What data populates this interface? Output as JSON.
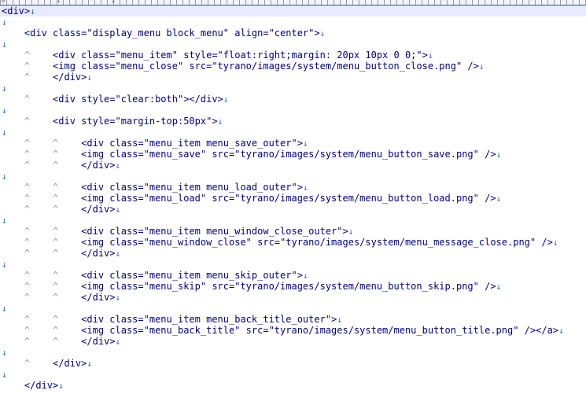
{
  "ruler": {
    "marks": [
      "0",
      "1",
      "2"
    ]
  },
  "editor": {
    "lines": [
      {
        "indent": "",
        "text": "<div>",
        "eol": "↓"
      },
      {
        "indent": "",
        "text": "",
        "eol": "↓"
      },
      {
        "indent": "    ",
        "text": "<div class=\"display_menu block_menu\" align=\"center\">",
        "eol": "↓"
      },
      {
        "indent": "",
        "text": "",
        "eol": "↓"
      },
      {
        "indent": "    ^    ",
        "text": "<div class=\"menu_item\" style=\"float:right;margin: 20px 10px 0 0;\">",
        "eol": "↓"
      },
      {
        "indent": "    ^    ",
        "text": "<img class=\"menu_close\" src=\"tyrano/images/system/menu_button_close.png\" />",
        "eol": "↓"
      },
      {
        "indent": "    ^    ",
        "text": "</div>",
        "eol": "↓"
      },
      {
        "indent": "",
        "text": "",
        "eol": "↓"
      },
      {
        "indent": "    ^    ",
        "text": "<div style=\"clear:both\"></div>",
        "eol": "↓"
      },
      {
        "indent": "",
        "text": "",
        "eol": "↓"
      },
      {
        "indent": "    ^    ",
        "text": "<div style=\"margin-top:50px\">",
        "eol": "↓"
      },
      {
        "indent": "",
        "text": "",
        "eol": "↓"
      },
      {
        "indent": "    ^    ^    ",
        "text": "<div class=\"menu_item menu_save_outer\">",
        "eol": "↓"
      },
      {
        "indent": "    ^    ^    ",
        "text": "<img class=\"menu_save\" src=\"tyrano/images/system/menu_button_save.png\" />",
        "eol": "↓"
      },
      {
        "indent": "    ^    ^    ",
        "text": "</div>",
        "eol": "↓"
      },
      {
        "indent": "",
        "text": "",
        "eol": "↓"
      },
      {
        "indent": "    ^    ^    ",
        "text": "<div class=\"menu_item menu_load_outer\">",
        "eol": "↓"
      },
      {
        "indent": "    ^    ^    ",
        "text": "<img class=\"menu_load\" src=\"tyrano/images/system/menu_button_load.png\" />",
        "eol": "↓"
      },
      {
        "indent": "    ^    ^    ",
        "text": "</div>",
        "eol": "↓"
      },
      {
        "indent": "",
        "text": "",
        "eol": "↓"
      },
      {
        "indent": "    ^    ^    ",
        "text": "<div class=\"menu_item menu_window_close_outer\">",
        "eol": "↓"
      },
      {
        "indent": "    ^    ^    ",
        "text": "<img class=\"menu_window_close\" src=\"tyrano/images/system/menu_message_close.png\" />",
        "eol": "↓"
      },
      {
        "indent": "    ^    ^    ",
        "text": "</div>",
        "eol": "↓"
      },
      {
        "indent": "",
        "text": "",
        "eol": "↓"
      },
      {
        "indent": "    ^    ^    ",
        "text": "<div class=\"menu_item menu_skip_outer\">",
        "eol": "↓"
      },
      {
        "indent": "    ^    ^    ",
        "text": "<img class=\"menu_skip\" src=\"tyrano/images/system/menu_button_skip.png\" />",
        "eol": "↓"
      },
      {
        "indent": "    ^    ^    ",
        "text": "</div>",
        "eol": "↓"
      },
      {
        "indent": "",
        "text": "",
        "eol": "↓"
      },
      {
        "indent": "    ^    ^    ",
        "text": "<div class=\"menu_item menu_back_title_outer\">",
        "eol": "↓"
      },
      {
        "indent": "    ^    ^    ",
        "text": "<img class=\"menu_back_title\" src=\"tyrano/images/system/menu_button_title.png\" /></a>",
        "eol": "↓"
      },
      {
        "indent": "    ^    ^    ",
        "text": "</div>",
        "eol": "↓"
      },
      {
        "indent": "",
        "text": "",
        "eol": "↓"
      },
      {
        "indent": "    ^    ",
        "text": "</div>",
        "eol": "↓"
      },
      {
        "indent": "",
        "text": "",
        "eol": "↓"
      },
      {
        "indent": "    ",
        "text": "</div>",
        "eol": "↓"
      }
    ]
  }
}
